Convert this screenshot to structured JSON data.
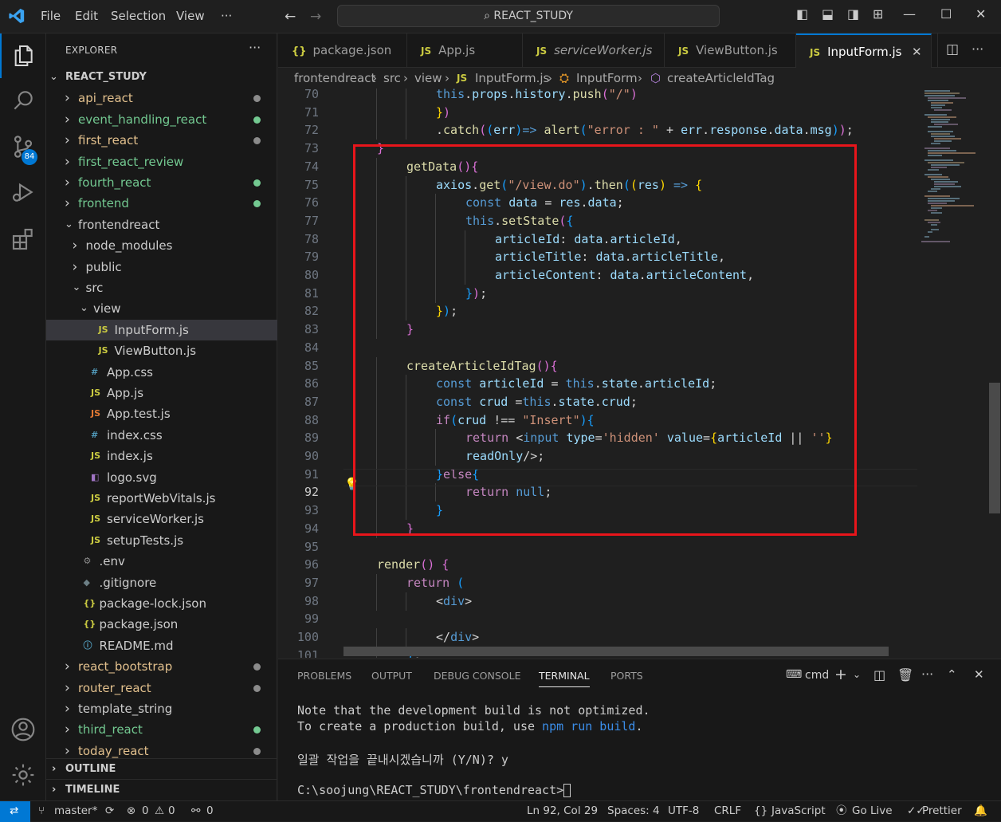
{
  "menu": {
    "file": "File",
    "edit": "Edit",
    "selection": "Selection",
    "view": "View",
    "more": "···"
  },
  "search": {
    "text": "REACT_STUDY"
  },
  "explorer": {
    "title": "EXPLORER",
    "more": "···"
  },
  "tree": [
    {
      "label": "REACT_STUDY",
      "type": "root",
      "depth": 0
    },
    {
      "label": "api_react",
      "type": "folder",
      "depth": 1,
      "color": "#e2c08d",
      "dot": "#8b8b8b"
    },
    {
      "label": "event_handling_react",
      "type": "folder",
      "depth": 1,
      "color": "#73c991",
      "dot": "#73c991"
    },
    {
      "label": "first_react",
      "type": "folder",
      "depth": 1,
      "color": "#e2c08d",
      "dot": "#8b8b8b"
    },
    {
      "label": "first_react_review",
      "type": "folder",
      "depth": 1,
      "color": "#73c991"
    },
    {
      "label": "fourth_react",
      "type": "folder",
      "depth": 1,
      "color": "#73c991",
      "dot": "#73c991"
    },
    {
      "label": "frontend",
      "type": "folder",
      "depth": 1,
      "color": "#73c991",
      "dot": "#73c991"
    },
    {
      "label": "frontendreact",
      "type": "openfolder",
      "depth": 1,
      "color": "#cccccc"
    },
    {
      "label": "node_modules",
      "type": "folder",
      "depth": 2,
      "color": "#cccccc"
    },
    {
      "label": "public",
      "type": "folder",
      "depth": 2,
      "color": "#cccccc"
    },
    {
      "label": "src",
      "type": "openfolder",
      "depth": 2,
      "color": "#cccccc"
    },
    {
      "label": "view",
      "type": "openfolder",
      "depth": 3,
      "color": "#cccccc"
    },
    {
      "label": "InputForm.js",
      "type": "js",
      "depth": 4,
      "color": "#cccccc",
      "selected": true
    },
    {
      "label": "ViewButton.js",
      "type": "js",
      "depth": 4,
      "color": "#cccccc"
    },
    {
      "label": "App.css",
      "type": "css",
      "depth": 3,
      "color": "#cccccc"
    },
    {
      "label": "App.js",
      "type": "js",
      "depth": 3,
      "color": "#cccccc"
    },
    {
      "label": "App.test.js",
      "type": "jstest",
      "depth": 3,
      "color": "#cccccc"
    },
    {
      "label": "index.css",
      "type": "css",
      "depth": 3,
      "color": "#cccccc"
    },
    {
      "label": "index.js",
      "type": "js",
      "depth": 3,
      "color": "#cccccc"
    },
    {
      "label": "logo.svg",
      "type": "svg",
      "depth": 3,
      "color": "#cccccc"
    },
    {
      "label": "reportWebVitals.js",
      "type": "js",
      "depth": 3,
      "color": "#cccccc"
    },
    {
      "label": "serviceWorker.js",
      "type": "js",
      "depth": 3,
      "color": "#cccccc"
    },
    {
      "label": "setupTests.js",
      "type": "js",
      "depth": 3,
      "color": "#cccccc"
    },
    {
      "label": ".env",
      "type": "gear",
      "depth": 2,
      "color": "#cccccc"
    },
    {
      "label": ".gitignore",
      "type": "git",
      "depth": 2,
      "color": "#cccccc"
    },
    {
      "label": "package-lock.json",
      "type": "json",
      "depth": 2,
      "color": "#cccccc"
    },
    {
      "label": "package.json",
      "type": "json",
      "depth": 2,
      "color": "#cccccc"
    },
    {
      "label": "README.md",
      "type": "info",
      "depth": 2,
      "color": "#cccccc"
    },
    {
      "label": "react_bootstrap",
      "type": "folder",
      "depth": 1,
      "color": "#e2c08d",
      "dot": "#8b8b8b"
    },
    {
      "label": "router_react",
      "type": "folder",
      "depth": 1,
      "color": "#e2c08d",
      "dot": "#8b8b8b"
    },
    {
      "label": "template_string",
      "type": "folder",
      "depth": 1,
      "color": "#cccccc"
    },
    {
      "label": "third_react",
      "type": "folder",
      "depth": 1,
      "color": "#73c991",
      "dot": "#73c991"
    },
    {
      "label": "today_react",
      "type": "folder",
      "depth": 1,
      "color": "#e2c08d",
      "dot": "#8b8b8b"
    }
  ],
  "outline": "OUTLINE",
  "timeline": "TIMELINE",
  "scm_badge": "84",
  "tabs": [
    {
      "label": "package.json",
      "icon": "{}",
      "italic": false
    },
    {
      "label": "App.js",
      "icon": "JS",
      "italic": false
    },
    {
      "label": "serviceWorker.js",
      "icon": "JS",
      "italic": true
    },
    {
      "label": "ViewButton.js",
      "icon": "JS",
      "italic": false
    },
    {
      "label": "InputForm.js",
      "icon": "JS",
      "italic": false,
      "active": true
    }
  ],
  "breadcrumb": [
    "frontendreact",
    "src",
    "view",
    "InputForm.js",
    "InputForm",
    "createArticleIdTag"
  ],
  "code": [
    {
      "n": "70",
      "cur": false,
      "html": "<span class='k'>this</span><span class='p'>.</span><span class='v'>props</span><span class='p'>.</span><span class='v'>history</span><span class='p'>.</span><span class='f'>push</span><span class='m'>(</span><span class='s'>\"/\"</span><span class='m'>)</span>",
      "indent": 3
    },
    {
      "n": "71",
      "html": "<span class='y'>}</span><span class='m'>)</span>",
      "indent": 3
    },
    {
      "n": "72",
      "html": "<span class='p'>.</span><span class='f'>catch</span><span class='m'>(</span><span class='b'>(</span><span class='v'>err</span><span class='b'>)</span><span class='t'>=&gt;</span> <span class='f'>alert</span><span class='b'>(</span><span class='s'>\"error : \"</span> <span class='p'>+</span> <span class='v'>err</span><span class='p'>.</span><span class='v'>response</span><span class='p'>.</span><span class='v'>data</span><span class='p'>.</span><span class='v'>msg</span><span class='b'>)</span><span class='m'>)</span><span class='p'>;</span>",
      "indent": 3
    },
    {
      "n": "73",
      "html": "<span class='m'>}</span>",
      "indent": 1
    },
    {
      "n": "74",
      "html": "<span class='f'>getData</span><span class='m'>()</span><span class='m'>{</span>",
      "indent": 2
    },
    {
      "n": "75",
      "html": "<span class='v'>axios</span><span class='p'>.</span><span class='f'>get</span><span class='b'>(</span><span class='s'>\"/view.do\"</span><span class='b'>)</span><span class='p'>.</span><span class='f'>then</span><span class='b'>(</span><span class='y'>(</span><span class='v'>res</span><span class='y'>)</span> <span class='t'>=&gt;</span> <span class='y'>{</span>",
      "indent": 3
    },
    {
      "n": "76",
      "html": "<span class='k'>const</span> <span class='v'>data</span> <span class='p'>=</span> <span class='v'>res</span><span class='p'>.</span><span class='v'>data</span><span class='p'>;</span>",
      "indent": 4
    },
    {
      "n": "77",
      "html": "<span class='k'>this</span><span class='p'>.</span><span class='f'>setState</span><span class='m'>(</span><span class='b'>{</span>",
      "indent": 4
    },
    {
      "n": "78",
      "html": "<span class='v'>articleId</span><span class='p'>:</span> <span class='v'>data</span><span class='p'>.</span><span class='v'>articleId</span><span class='p'>,</span>",
      "indent": 5
    },
    {
      "n": "79",
      "html": "<span class='v'>articleTitle</span><span class='p'>:</span> <span class='v'>data</span><span class='p'>.</span><span class='v'>articleTitle</span><span class='p'>,</span>",
      "indent": 5
    },
    {
      "n": "80",
      "html": "<span class='v'>articleContent</span><span class='p'>:</span> <span class='v'>data</span><span class='p'>.</span><span class='v'>articleContent</span><span class='p'>,</span>",
      "indent": 5
    },
    {
      "n": "81",
      "html": "<span class='b'>}</span><span class='m'>)</span><span class='p'>;</span>",
      "indent": 4
    },
    {
      "n": "82",
      "html": "<span class='y'>}</span><span class='b'>)</span><span class='p'>;</span>",
      "indent": 3
    },
    {
      "n": "83",
      "html": "<span class='m'>}</span>",
      "indent": 2
    },
    {
      "n": "84",
      "html": "",
      "indent": 0
    },
    {
      "n": "85",
      "html": "<span class='f'>createArticleIdTag</span><span class='m'>()</span><span class='m'>{</span>",
      "indent": 2
    },
    {
      "n": "86",
      "html": "<span class='k'>const</span> <span class='v'>articleId</span> <span class='p'>=</span> <span class='k'>this</span><span class='p'>.</span><span class='v'>state</span><span class='p'>.</span><span class='v'>articleId</span><span class='p'>;</span>",
      "indent": 3
    },
    {
      "n": "87",
      "html": "<span class='k'>const</span> <span class='v'>crud</span> <span class='p'>=</span><span class='k'>this</span><span class='p'>.</span><span class='v'>state</span><span class='p'>.</span><span class='v'>crud</span><span class='p'>;</span>",
      "indent": 3
    },
    {
      "n": "88",
      "html": "<span class='q'>if</span><span class='b'>(</span><span class='v'>crud</span> <span class='p'>!==</span> <span class='s'>\"Insert\"</span><span class='b'>)</span><span class='b'>{</span>",
      "indent": 3
    },
    {
      "n": "89",
      "html": "<span class='q'>return</span> <span class='p'>&lt;</span><span class='k'>input</span> <span class='v'>type</span><span class='p'>=</span><span class='s'>'hidden'</span> <span class='v'>value</span><span class='p'>=</span><span class='y'>{</span><span class='v'>articleId</span> <span class='p'>||</span> <span class='s'>''</span><span class='y'>}</span>",
      "indent": 4
    },
    {
      "n": "90",
      "html": "<span class='v'>readOnly</span><span class='p'>/&gt;;</span>",
      "indent": 4
    },
    {
      "n": "91",
      "html": "<span class='b'>}</span><span class='q'>else</span><span class='b'>{</span>",
      "indent": 3
    },
    {
      "n": "92",
      "cur": true,
      "html": "<span class='q'>return</span> <span class='k'>null</span><span class='p'>;</span>",
      "indent": 4
    },
    {
      "n": "93",
      "html": "<span class='b'>}</span>",
      "indent": 3
    },
    {
      "n": "94",
      "html": "<span class='m'>}</span>",
      "indent": 2
    },
    {
      "n": "95",
      "html": "",
      "indent": 0
    },
    {
      "n": "96",
      "html": "<span class='f'>render</span><span class='m'>()</span> <span class='m'>{</span>",
      "indent": 1
    },
    {
      "n": "97",
      "html": "<span class='q'>return</span> <span class='b'>(</span>",
      "indent": 2
    },
    {
      "n": "98",
      "html": "<span class='p'>&lt;</span><span class='k'>div</span><span class='p'>&gt;</span>",
      "indent": 3
    },
    {
      "n": "99",
      "html": "",
      "indent": 0
    },
    {
      "n": "100",
      "html": "<span class='p'>&lt;/</span><span class='k'>div</span><span class='p'>&gt;</span>",
      "indent": 3
    },
    {
      "n": "101",
      "html": "<span class='b'>)</span><span class='p'>;</span>",
      "indent": 2
    }
  ],
  "panel": {
    "tabs": [
      "PROBLEMS",
      "OUTPUT",
      "DEBUG CONSOLE",
      "TERMINAL",
      "PORTS"
    ],
    "shell": "cmd",
    "terminal_lines": [
      "Note that the development build is not optimized.",
      "To create a production build, use npm run build.",
      "",
      "일괄 작업을 끝내시겠습니까 (Y/N)? y",
      "",
      "C:\\soojung\\REACT_STUDY\\frontendreact>"
    ]
  },
  "status": {
    "branch": "master*",
    "errors": "0",
    "warnings": "0",
    "ports": "0",
    "position": "Ln 92, Col 29",
    "spaces": "Spaces: 4",
    "encoding": "UTF-8",
    "eol": "CRLF",
    "language": "JavaScript",
    "golive": "Go Live",
    "prettier": "Prettier"
  },
  "colors": {
    "accent": "#0078d4",
    "highlight_box": "#e8151b",
    "badge": "#0078d4"
  }
}
